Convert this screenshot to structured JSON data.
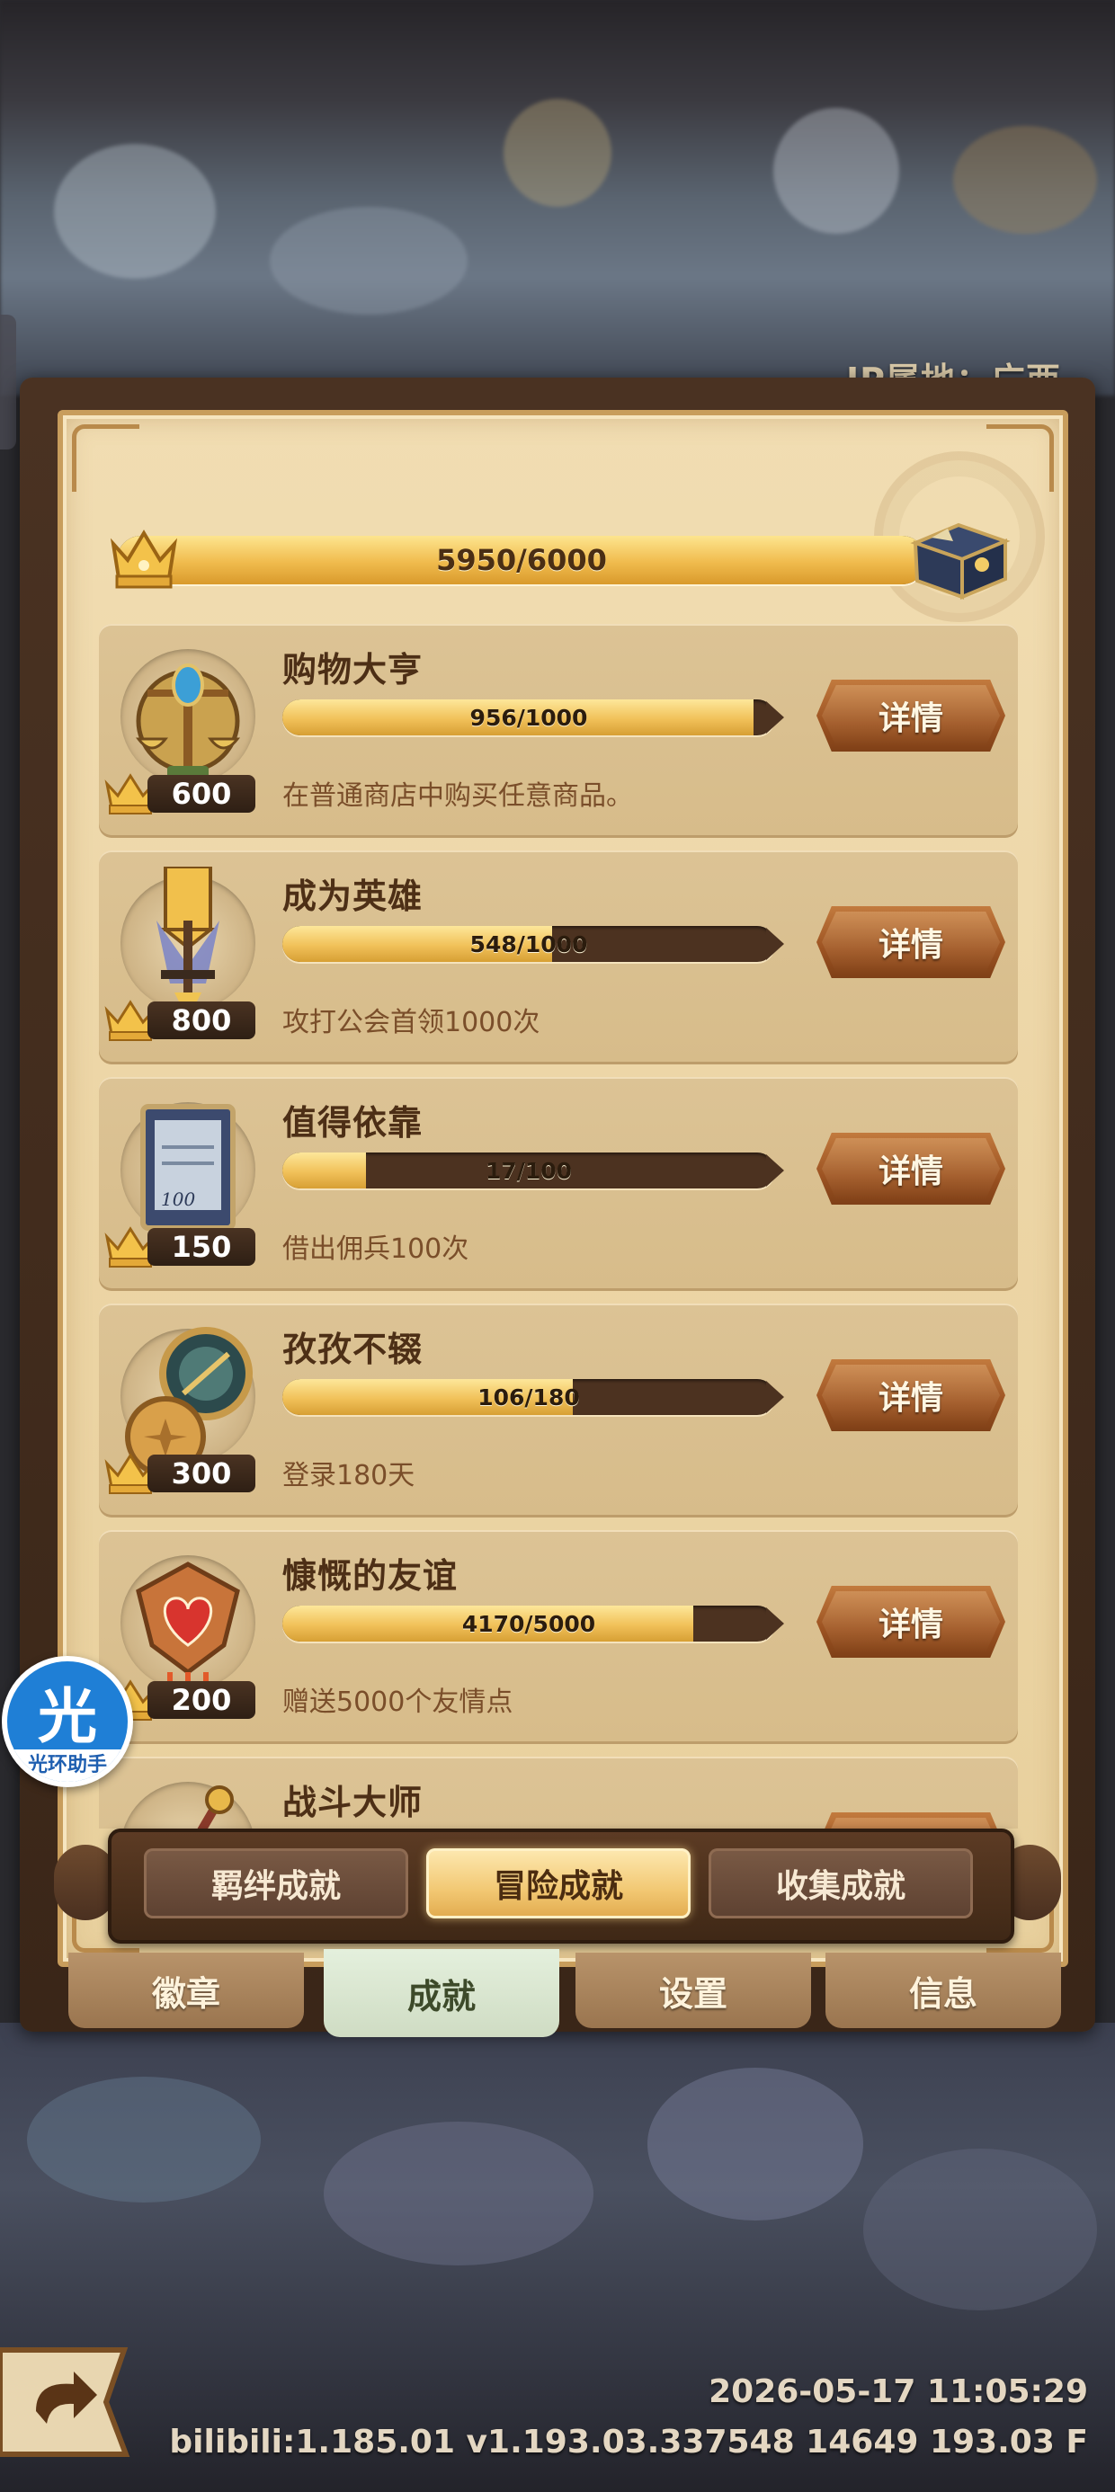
{
  "ip_location": "IP属地：广西",
  "total_progress": {
    "text": "5950/6000",
    "current": 5950,
    "max": 6000
  },
  "achievements": [
    {
      "title": "购物大亨",
      "progress_text": "956/1000",
      "current": 956,
      "max": 1000,
      "description": "在普通商店中购买任意商品。",
      "points": "600",
      "detail_label": "详情",
      "icon": "scales-icon"
    },
    {
      "title": "成为英雄",
      "progress_text": "548/1000",
      "current": 548,
      "max": 1000,
      "description": "攻打公会首领1000次",
      "points": "800",
      "detail_label": "详情",
      "icon": "sword-banner-icon"
    },
    {
      "title": "值得依靠",
      "progress_text": "17/100",
      "current": 17,
      "max": 100,
      "description": "借出佣兵100次",
      "points": "150",
      "detail_label": "详情",
      "icon": "contract-frame-icon"
    },
    {
      "title": "孜孜不辍",
      "progress_text": "106/180",
      "current": 106,
      "max": 180,
      "description": "登录180天",
      "points": "300",
      "detail_label": "详情",
      "icon": "compass-coin-icon"
    },
    {
      "title": "慷慨的友谊",
      "progress_text": "4170/5000",
      "current": 4170,
      "max": 5000,
      "description": "赠送5000个友情点",
      "points": "200",
      "detail_label": "详情",
      "icon": "heart-emblem-icon"
    },
    {
      "title": "战斗大师",
      "progress_text": "",
      "current": 0,
      "max": 0,
      "description": "",
      "points": "",
      "detail_label": "详情",
      "icon": "battle-staff-icon"
    }
  ],
  "segments": [
    {
      "label": "羁绊成就",
      "active": false
    },
    {
      "label": "冒险成就",
      "active": true
    },
    {
      "label": "收集成就",
      "active": false
    }
  ],
  "main_tabs": [
    {
      "label": "徽章",
      "active": false
    },
    {
      "label": "成就",
      "active": true
    },
    {
      "label": "设置",
      "active": false
    },
    {
      "label": "信息",
      "active": false
    }
  ],
  "assistant": {
    "glyph": "光",
    "label": "光环助手"
  },
  "footer": {
    "timestamp": "2026-05-17 11:05:29",
    "version": "bilibili:1.185.01  v1.193.03.337548 14649 193.03 F"
  },
  "colors": {
    "panel": "#ecd5a5",
    "card": "#d9bf8f",
    "button": "#a45b27",
    "progress_fill": "#f0bb4d",
    "active_tab": "#d5e2ca"
  }
}
